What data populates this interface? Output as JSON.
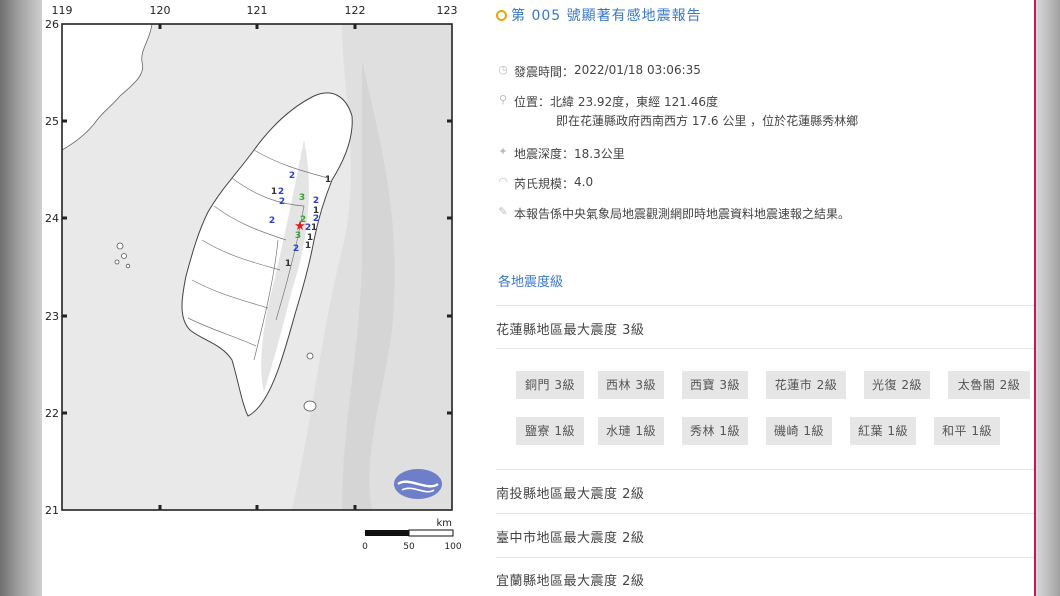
{
  "map": {
    "lon_ticks": [
      "119",
      "120",
      "121",
      "122",
      "123"
    ],
    "lat_ticks": [
      "26",
      "25",
      "24",
      "23",
      "22",
      "21"
    ],
    "scale_unit": "km",
    "scale_labels": [
      "0",
      "50",
      "100"
    ],
    "epicenter_symbol": "★",
    "intensity_labels": [
      {
        "v": "2",
        "c": "#2a3fd1"
      },
      {
        "v": "1",
        "c": "#333333"
      },
      {
        "v": "2",
        "c": "#2a3fd1"
      },
      {
        "v": "2",
        "c": "#2a3fd1"
      },
      {
        "v": "2",
        "c": "#2a3fd1"
      },
      {
        "v": "3",
        "c": "#3aa336"
      },
      {
        "v": "2",
        "c": "#2a3fd1"
      },
      {
        "v": "1",
        "c": "#333333"
      },
      {
        "v": "2",
        "c": "#2a3fd1"
      },
      {
        "v": "2",
        "c": "#3aa336"
      },
      {
        "v": "2",
        "c": "#2a3fd1"
      },
      {
        "v": "1",
        "c": "#333333"
      },
      {
        "v": "3",
        "c": "#3aa336"
      },
      {
        "v": "1",
        "c": "#333333"
      },
      {
        "v": "2",
        "c": "#2a3fd1"
      },
      {
        "v": "1",
        "c": "#333333"
      },
      {
        "v": "1",
        "c": "#333333"
      },
      {
        "v": "1",
        "c": "#333333"
      }
    ],
    "colors": {
      "land": "#ffffff",
      "sea": "#e9e9e9",
      "frame": "#222222",
      "epicenter": "#e02020"
    }
  },
  "report": {
    "title": "第 005 號顯著有感地震報告",
    "time": {
      "label": "發震時間：",
      "value": "2022/01/18 03:06:35"
    },
    "location": {
      "label": "位置：",
      "value": "北緯 23.92度，東經 121.46度",
      "detail": "即在花蓮縣政府西南西方 17.6 公里 ，位於花蓮縣秀林鄉"
    },
    "depth": {
      "label": "地震深度：",
      "value": "18.3公里"
    },
    "magnitude": {
      "label": "芮氏規模：",
      "value": "4.0"
    },
    "note": "本報告係中央氣象局地震觀測網即時地震資料地震速報之結果。",
    "icons": [
      "clock-icon",
      "pin-icon",
      "star-icon",
      "wave-icon",
      "pen-icon"
    ]
  },
  "intensity_section": {
    "title": "各地震度級",
    "counties": [
      {
        "name": "花蓮縣地區最大震度 3級",
        "stations": [
          "銅門 3級",
          "西林 3級",
          "西寶 3級",
          "花蓮市 2級",
          "光復 2級",
          "太魯閣 2級",
          "鹽寮 1級",
          "水璉 1級",
          "秀林 1級",
          "磯崎 1級",
          "紅葉 1級",
          "和平 1級"
        ]
      },
      {
        "name": "南投縣地區最大震度 2級"
      },
      {
        "name": "臺中市地區最大震度 2級"
      },
      {
        "name": "宜蘭縣地區最大震度 2級"
      }
    ]
  }
}
